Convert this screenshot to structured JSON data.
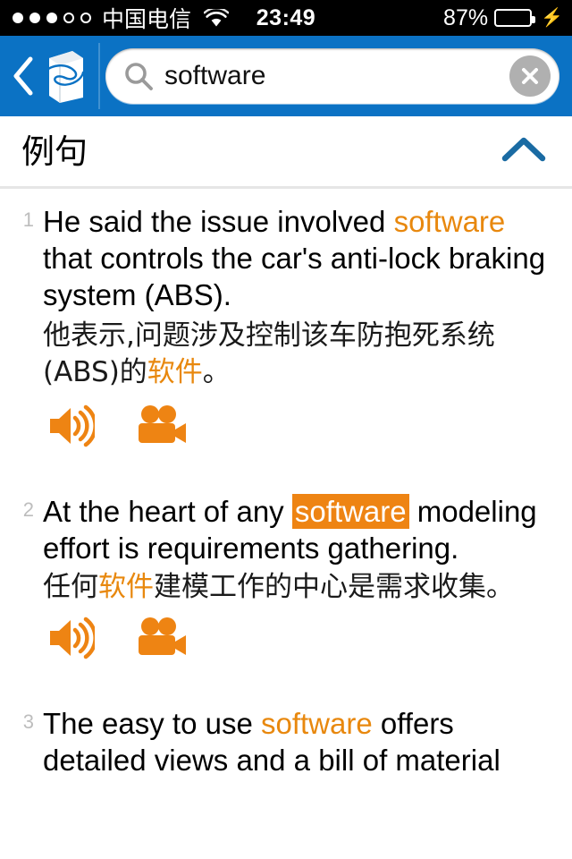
{
  "status_bar": {
    "signal_dots_filled": 3,
    "signal_dots_total": 5,
    "carrier": "中国电信",
    "wifi_icon": "wifi-icon",
    "time": "23:49",
    "battery_percent": "87%",
    "battery_level": 87,
    "battery_charging": true,
    "battery_color": "#3ad545",
    "background": "#000000"
  },
  "navbar": {
    "background": "#0b72c4",
    "back_icon": "back-chevron-icon",
    "logo_icon": "book-logo-icon",
    "search": {
      "icon": "search-icon",
      "value": "software",
      "placeholder": "Search",
      "clear_icon": "clear-circle-icon",
      "clear_button_color": "#b0b0b0"
    }
  },
  "section": {
    "title": "例句",
    "collapse_icon": "chevron-up-icon",
    "collapse_icon_color": "#1a6ba3"
  },
  "theme": {
    "keyword_color": "#e8880e",
    "keyword_highlight_bg": "#ee8413",
    "keyword_highlight_fg": "#ffffff",
    "action_icon_color": "#ee8413"
  },
  "examples": [
    {
      "number": "1",
      "en_parts": [
        {
          "text": "He said the issue involved ",
          "style": "plain"
        },
        {
          "text": "software",
          "style": "keyword"
        },
        {
          "text": " that controls the car's anti-lock braking system (ABS).",
          "style": "plain"
        }
      ],
      "en_full": "He said the issue involved software that controls the car's anti-lock braking system (ABS).",
      "zh_parts": [
        {
          "text": "他表示,问题涉及控制该车防抱死系统(ABS)的",
          "style": "plain"
        },
        {
          "text": "软件",
          "style": "keyword"
        },
        {
          "text": "。",
          "style": "plain"
        }
      ],
      "zh_full": "他表示,问题涉及控制该车防抱死系统(ABS)的软件。",
      "actions": [
        {
          "icon": "speaker-audio-icon",
          "label": "Play audio"
        },
        {
          "icon": "video-camera-icon",
          "label": "Play video"
        }
      ]
    },
    {
      "number": "2",
      "en_parts": [
        {
          "text": "At the heart of any ",
          "style": "plain"
        },
        {
          "text": "software",
          "style": "keyword-highlight"
        },
        {
          "text": " modeling effort is requirements gathering.",
          "style": "plain"
        }
      ],
      "en_full": "At the heart of any software modeling effort is requirements gathering.",
      "zh_parts": [
        {
          "text": "任何",
          "style": "plain"
        },
        {
          "text": "软件",
          "style": "keyword"
        },
        {
          "text": "建模工作的中心是需求收集。",
          "style": "plain"
        }
      ],
      "zh_full": "任何软件建模工作的中心是需求收集。",
      "actions": [
        {
          "icon": "speaker-audio-icon",
          "label": "Play audio"
        },
        {
          "icon": "video-camera-icon",
          "label": "Play video"
        }
      ]
    },
    {
      "number": "3",
      "en_parts": [
        {
          "text": "The easy to use ",
          "style": "plain"
        },
        {
          "text": "software",
          "style": "keyword"
        },
        {
          "text": " offers detailed views and a bill of material",
          "style": "plain"
        }
      ],
      "en_full": "The easy to use software offers detailed views and a bill of material",
      "zh_parts": [],
      "zh_full": "",
      "actions": []
    }
  ]
}
